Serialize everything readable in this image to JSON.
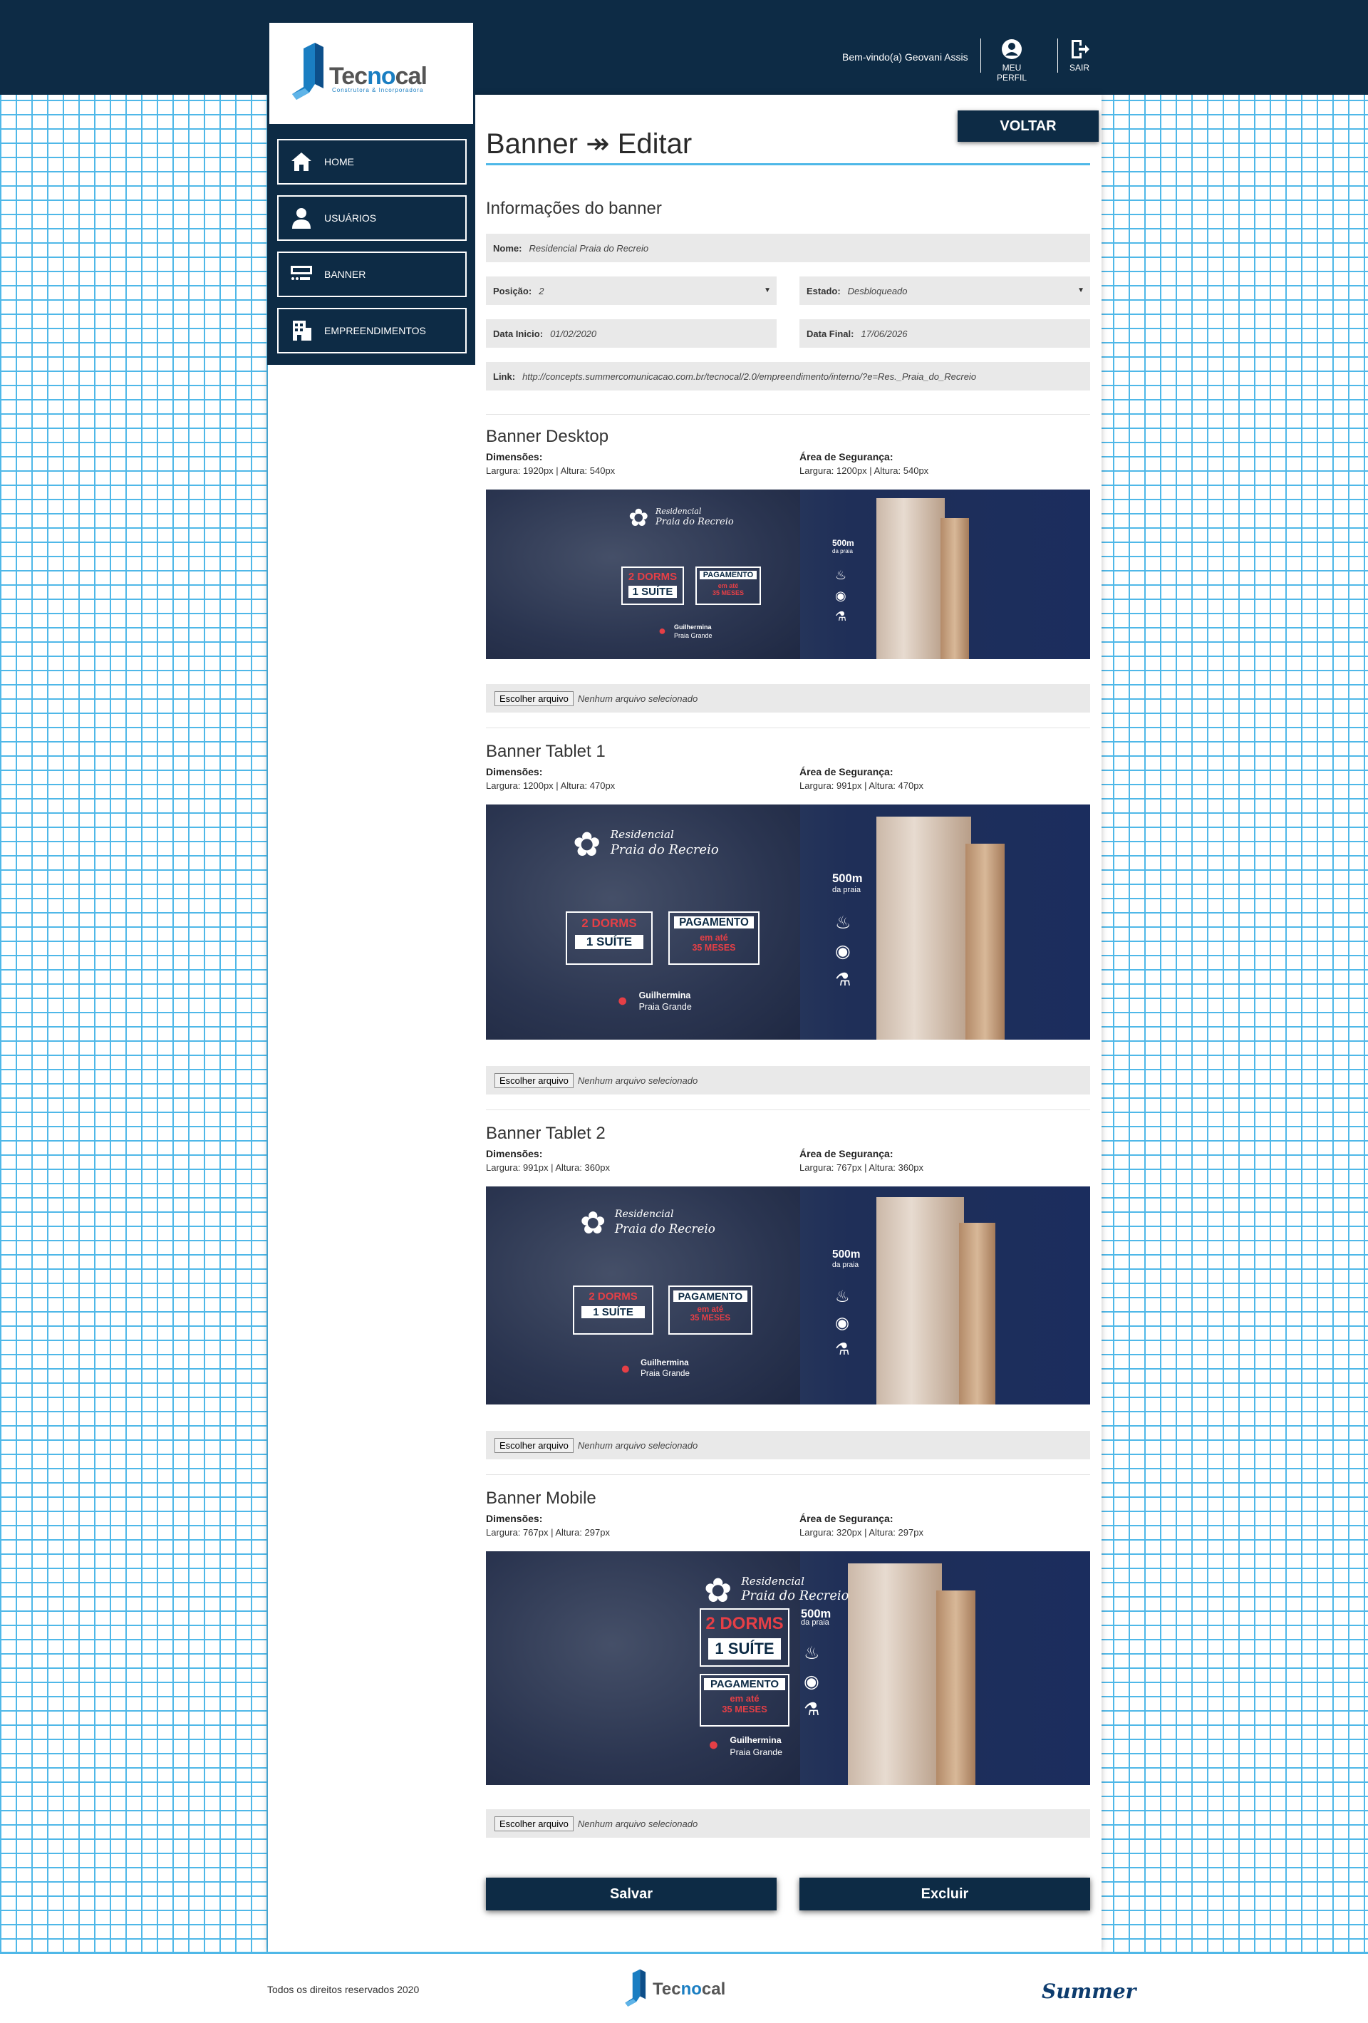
{
  "header": {
    "welcome": "Bem-vindo(a) Geovani Assis",
    "profile_label": "MEU PERFIL",
    "logout_label": "SAIR"
  },
  "brand": {
    "name_part1": "Tec",
    "name_part2": "no",
    "name_part3": "cal",
    "tagline": "Construtora & Incorporadora"
  },
  "sidebar": {
    "items": [
      {
        "label": "HOME",
        "icon": "home-icon"
      },
      {
        "label": "USUÁRIOS",
        "icon": "user-icon"
      },
      {
        "label": "BANNER",
        "icon": "banner-icon"
      },
      {
        "label": "EMPREENDIMENTOS",
        "icon": "building-icon"
      }
    ]
  },
  "page": {
    "title": "Banner ↠ Editar",
    "back_label": "VOLTAR"
  },
  "info": {
    "title": "Informações do banner",
    "nome_label": "Nome:",
    "nome_value": "Residencial Praia do Recreio",
    "posicao_label": "Posição:",
    "posicao_value": "2",
    "estado_label": "Estado:",
    "estado_value": "Desbloqueado",
    "data_inicio_label": "Data Inicio:",
    "data_inicio_value": "01/02/2020",
    "data_final_label": "Data Final:",
    "data_final_value": "17/06/2026",
    "link_label": "Link:",
    "link_value": "http://concepts.summercomunicacao.com.br/tecnocal/2.0/empreendimento/interno/?e=Res._Praia_do_Recreio"
  },
  "dims_label": "Dimensões:",
  "safe_label": "Área de Segurança:",
  "file_button": "Escolher arquivo",
  "file_status": "Nenhum arquivo selecionado",
  "banners": [
    {
      "title": "Banner Desktop",
      "dims": "Largura: 1920px | Altura: 540px",
      "safe": "Largura: 1200px | Altura: 540px"
    },
    {
      "title": "Banner Tablet 1",
      "dims": "Largura: 1200px | Altura: 470px",
      "safe": "Largura: 991px | Altura: 470px"
    },
    {
      "title": "Banner Tablet 2",
      "dims": "Largura: 991px | Altura: 360px",
      "safe": "Largura: 767px | Altura: 360px"
    },
    {
      "title": "Banner Mobile",
      "dims": "Largura: 767px | Altura: 297px",
      "safe": "Largura: 320px | Altura: 297px"
    }
  ],
  "banner_art": {
    "residencial": "Residencial",
    "name": "Praia do Recreio",
    "dorms": "2 DORMS",
    "suite": "1 SUÍTE",
    "pagamento": "PAGAMENTO",
    "em_ate": "em até",
    "meses": "35 MESES",
    "distance": "500m",
    "da_praia": "da praia",
    "loc1": "Guilhermina",
    "loc2": "Praia Grande"
  },
  "actions": {
    "save": "Salvar",
    "delete": "Excluir"
  },
  "footer": {
    "copyright": "Todos os direitos reservados 2020",
    "partner": "Summer"
  },
  "colors": {
    "navy": "#0d2b45",
    "accent_blue": "#4fb8e8",
    "field_bg": "#e9e9e9",
    "highlight_red": "#e53f46"
  }
}
